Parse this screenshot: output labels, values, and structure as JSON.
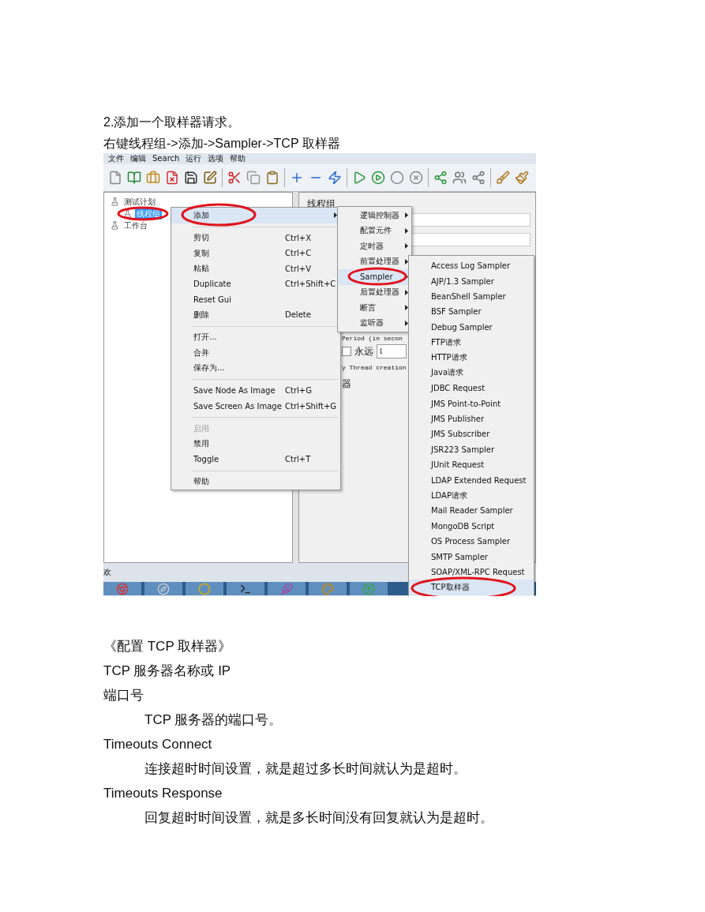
{
  "heading": "2.添加一个取样器请求。",
  "instruction": "右键线程组->添加->Sampler->TCP 取样器",
  "screenshot": {
    "menubar": [
      "文件",
      "编辑",
      "Search",
      "运行",
      "选项",
      "帮助"
    ],
    "tree": [
      {
        "label": "测试计划",
        "selected": false,
        "circled": false,
        "children": [
          {
            "label": "线程组",
            "selected": true,
            "circled": true
          }
        ]
      },
      {
        "label": "工作台",
        "selected": false,
        "circled": false
      }
    ],
    "panel": {
      "title": "线程组",
      "period_label": "Period (in secon",
      "forever": {
        "label": "永远",
        "checked": false
      },
      "loop_value": "1",
      "delay_text": "y Thread creation",
      "section_label": "器"
    },
    "status_text": "欢",
    "context_menu": [
      {
        "kind": "item",
        "label": "添加",
        "submenu": true,
        "highlighted": true,
        "disabled": false,
        "circled": true
      },
      {
        "kind": "separator"
      },
      {
        "kind": "item",
        "label": "剪切",
        "shortcut": "Ctrl+X",
        "submenu": false,
        "highlighted": false,
        "disabled": false,
        "circled": false
      },
      {
        "kind": "item",
        "label": "复制",
        "shortcut": "Ctrl+C",
        "submenu": false,
        "highlighted": false,
        "disabled": false,
        "circled": false
      },
      {
        "kind": "item",
        "label": "粘贴",
        "shortcut": "Ctrl+V",
        "submenu": false,
        "highlighted": false,
        "disabled": false,
        "circled": false
      },
      {
        "kind": "item",
        "label": "Duplicate",
        "shortcut": "Ctrl+Shift+C",
        "submenu": false,
        "highlighted": false,
        "disabled": false,
        "circled": false
      },
      {
        "kind": "item",
        "label": "Reset Gui",
        "submenu": false,
        "highlighted": false,
        "disabled": false,
        "circled": false
      },
      {
        "kind": "item",
        "label": "删除",
        "shortcut": "Delete",
        "submenu": false,
        "highlighted": false,
        "disabled": false,
        "circled": false
      },
      {
        "kind": "separator"
      },
      {
        "kind": "item",
        "label": "打开...",
        "submenu": false,
        "highlighted": false,
        "disabled": false,
        "circled": false
      },
      {
        "kind": "item",
        "label": "合并",
        "submenu": false,
        "highlighted": false,
        "disabled": false,
        "circled": false
      },
      {
        "kind": "item",
        "label": "保存为...",
        "submenu": false,
        "highlighted": false,
        "disabled": false,
        "circled": false
      },
      {
        "kind": "separator"
      },
      {
        "kind": "item",
        "label": "Save Node As Image",
        "shortcut": "Ctrl+G",
        "submenu": false,
        "highlighted": false,
        "disabled": false,
        "circled": false
      },
      {
        "kind": "item",
        "label": "Save Screen As Image",
        "shortcut": "Ctrl+Shift+G",
        "submenu": false,
        "highlighted": false,
        "disabled": false,
        "circled": false
      },
      {
        "kind": "separator"
      },
      {
        "kind": "item",
        "label": "启用",
        "submenu": false,
        "highlighted": false,
        "disabled": true,
        "circled": false
      },
      {
        "kind": "item",
        "label": "禁用",
        "submenu": false,
        "highlighted": false,
        "disabled": false,
        "circled": false
      },
      {
        "kind": "item",
        "label": "Toggle",
        "shortcut": "Ctrl+T",
        "submenu": false,
        "highlighted": false,
        "disabled": false,
        "circled": false
      },
      {
        "kind": "separator"
      },
      {
        "kind": "item",
        "label": "帮助",
        "submenu": false,
        "highlighted": false,
        "disabled": false,
        "circled": false
      }
    ],
    "add_menu": [
      {
        "label": "逻辑控制器",
        "selected": false,
        "circled": false
      },
      {
        "label": "配置元件",
        "selected": false,
        "circled": false
      },
      {
        "label": "定时器",
        "selected": false,
        "circled": false
      },
      {
        "label": "前置处理器",
        "selected": false,
        "circled": false
      },
      {
        "label": "Sampler",
        "selected": true,
        "circled": true
      },
      {
        "label": "后置处理器",
        "selected": false,
        "circled": false
      },
      {
        "label": "断言",
        "selected": false,
        "circled": false
      },
      {
        "label": "监听器",
        "selected": false,
        "circled": false
      }
    ],
    "sampler_menu": [
      {
        "label": "Access Log Sampler",
        "selected": false,
        "circled": false
      },
      {
        "label": "AJP/1.3 Sampler",
        "selected": false,
        "circled": false
      },
      {
        "label": "BeanShell Sampler",
        "selected": false,
        "circled": false
      },
      {
        "label": "BSF Sampler",
        "selected": false,
        "circled": false
      },
      {
        "label": "Debug Sampler",
        "selected": false,
        "circled": false
      },
      {
        "label": "FTP请求",
        "selected": false,
        "circled": false
      },
      {
        "label": "HTTP请求",
        "selected": false,
        "circled": false
      },
      {
        "label": "Java请求",
        "selected": false,
        "circled": false
      },
      {
        "label": "JDBC Request",
        "selected": false,
        "circled": false
      },
      {
        "label": "JMS Point-to-Point",
        "selected": false,
        "circled": false
      },
      {
        "label": "JMS Publisher",
        "selected": false,
        "circled": false
      },
      {
        "label": "JMS Subscriber",
        "selected": false,
        "circled": false
      },
      {
        "label": "JSR223 Sampler",
        "selected": false,
        "circled": false
      },
      {
        "label": "JUnit Request",
        "selected": false,
        "circled": false
      },
      {
        "label": "LDAP Extended Request",
        "selected": false,
        "circled": false
      },
      {
        "label": "LDAP请求",
        "selected": false,
        "circled": false
      },
      {
        "label": "Mail Reader Sampler",
        "selected": false,
        "circled": false
      },
      {
        "label": "MongoDB Script",
        "selected": false,
        "circled": false
      },
      {
        "label": "OS Process Sampler",
        "selected": false,
        "circled": false
      },
      {
        "label": "SMTP Sampler",
        "selected": false,
        "circled": false
      },
      {
        "label": "SOAP/XML-RPC Request",
        "selected": false,
        "circled": false
      },
      {
        "label": "TCP取样器",
        "selected": true,
        "circled": true
      }
    ]
  },
  "section_title": "《配置 TCP 取样器》",
  "fields": [
    {
      "name": "TCP 服务器名称或 IP"
    },
    {
      "name": "端口号",
      "description": "TCP 服务器的端口号。"
    },
    {
      "name": "Timeouts Connect",
      "description": "连接超时时间设置，就是超过多长时间就认为是超时。"
    },
    {
      "name": "Timeouts Response",
      "description": "回复超时时间设置，就是多长时间没有回复就认为是超时。"
    }
  ]
}
